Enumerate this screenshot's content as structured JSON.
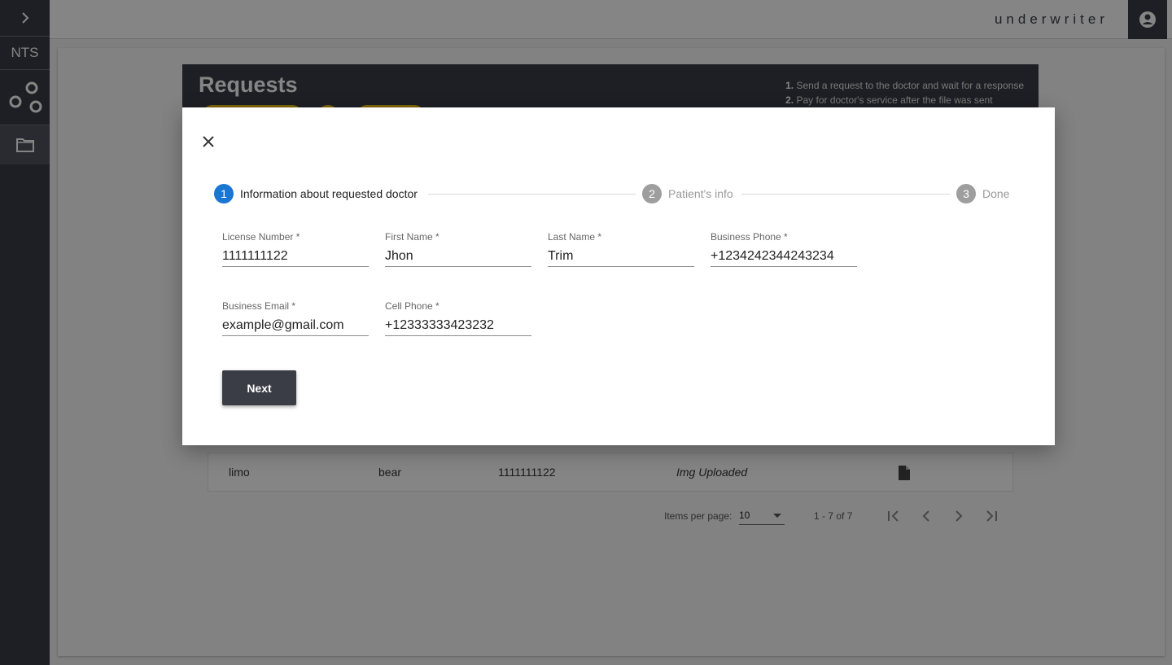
{
  "sidebar": {
    "brand": "NTS"
  },
  "header": {
    "role": "underwriter"
  },
  "requests": {
    "title": "Requests",
    "steps": [
      {
        "num": "1.",
        "text": "Send a request to the doctor and wait for a response"
      },
      {
        "num": "2.",
        "text": "Pay for doctor's service after the file was sent"
      }
    ]
  },
  "table": {
    "row": {
      "first_name": "limo",
      "last_name": "bear",
      "license": "1111111122",
      "status": "Img Uploaded"
    }
  },
  "paginator": {
    "items_per_page_label": "Items per page:",
    "items_per_page_value": "10",
    "range": "1 - 7 of 7"
  },
  "dialog": {
    "stepper": [
      {
        "num": "1",
        "label": "Information about requested doctor",
        "state": "active"
      },
      {
        "num": "2",
        "label": "Patient's info",
        "state": "inactive"
      },
      {
        "num": "3",
        "label": "Done",
        "state": "inactive"
      }
    ],
    "fields": {
      "license_number": {
        "label": "License Number *",
        "value": "1111111122"
      },
      "first_name": {
        "label": "First Name *",
        "value": "Jhon"
      },
      "last_name": {
        "label": "Last Name *",
        "value": "Trim"
      },
      "business_phone": {
        "label": "Business Phone *",
        "value": "+1234242344243234"
      },
      "business_email": {
        "label": "Business Email *",
        "value": "example@gmail.com"
      },
      "cell_phone": {
        "label": "Cell Phone *",
        "value": "+12333333423232"
      }
    },
    "next_label": "Next"
  },
  "colors": {
    "primary_dark": "#3a3d45",
    "step_active": "#1976d2",
    "step_inactive": "#9e9e9e",
    "chip": "#f1c40f"
  }
}
